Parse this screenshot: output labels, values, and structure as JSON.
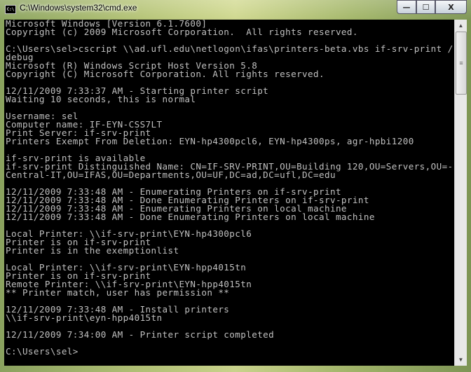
{
  "window": {
    "title": "C:\\Windows\\system32\\cmd.exe",
    "icon": "cmd-icon",
    "controls": {
      "minimize": "—",
      "maximize": "☐",
      "close": "X"
    }
  },
  "console": {
    "lines": [
      "Microsoft Windows [Version 6.1.7600]",
      "Copyright (c) 2009 Microsoft Corporation.  All rights reserved.",
      "",
      "C:\\Users\\sel>cscript \\\\ad.ufl.edu\\netlogon\\ifas\\printers-beta.vbs if-srv-print /",
      "debug",
      "Microsoft (R) Windows Script Host Version 5.8",
      "Copyright (C) Microsoft Corporation. All rights reserved.",
      "",
      "12/11/2009 7:33:37 AM - Starting printer script",
      "Waiting 10 seconds, this is normal",
      "",
      "Username: sel",
      "Computer name: IF-EYN-CSS7LT",
      "Print Server: if-srv-print",
      "Printers Exempt From Deletion: EYN-hp4300pcl6, EYN-hp4300ps, agr-hpbi1200",
      "",
      "if-srv-print is available",
      "if-srv-print Distinguished Name: CN=IF-SRV-PRINT,OU=Building 120,OU=Servers,OU=-",
      "Central-IT,OU=IFAS,OU=Departments,OU=UF,DC=ad,DC=ufl,DC=edu",
      "",
      "12/11/2009 7:33:48 AM - Enumerating Printers on if-srv-print",
      "12/11/2009 7:33:48 AM - Done Enumerating Printers on if-srv-print",
      "12/11/2009 7:33:48 AM - Enumerating Printers on local machine",
      "12/11/2009 7:33:48 AM - Done Enumerating Printers on local machine",
      "",
      "Local Printer: \\\\if-srv-print\\EYN-hp4300pcl6",
      "Printer is on if-srv-print",
      "Printer is in the exemptionlist",
      "",
      "Local Printer: \\\\if-srv-print\\EYN-hpp4015tn",
      "Printer is on if-srv-print",
      "Remote Printer: \\\\if-srv-print\\EYN-hpp4015tn",
      "** Printer match, user has permission **",
      "",
      "12/11/2009 7:33:48 AM - Install printers",
      "\\\\if-srv-print\\eyn-hpp4015tn",
      "",
      "12/11/2009 7:34:00 AM - Printer script completed",
      "",
      "C:\\Users\\sel>"
    ]
  },
  "scrollbar": {
    "up": "▲",
    "down": "▼",
    "grip": "≡"
  },
  "colors": {
    "console_bg": "#000000",
    "console_text": "#c0c0c0"
  }
}
